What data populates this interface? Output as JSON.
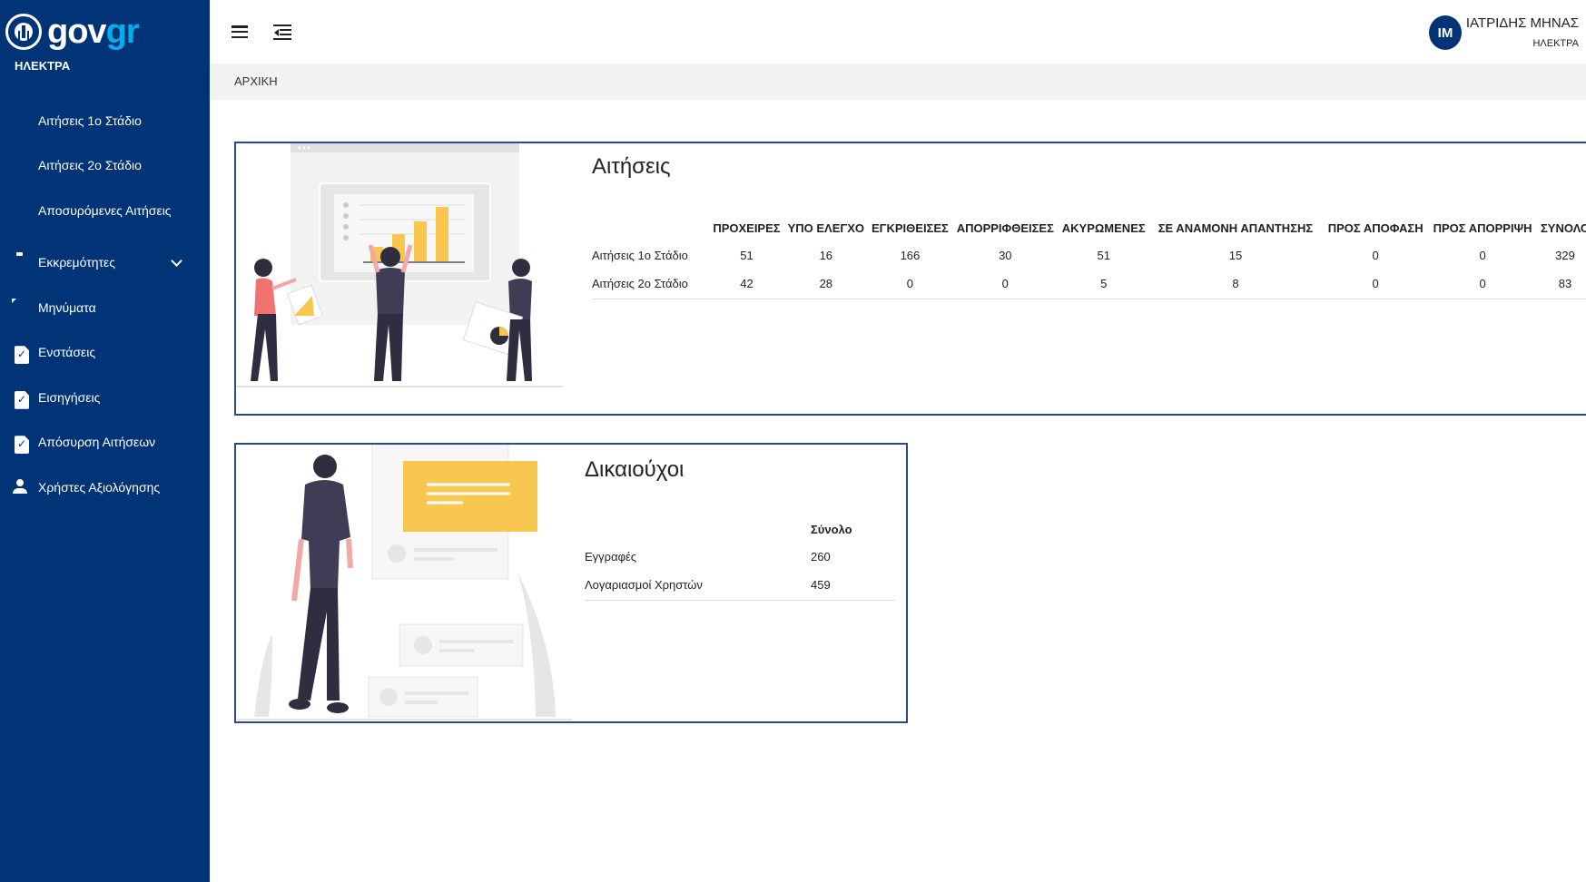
{
  "sidebar": {
    "logo_gov": "gov",
    "logo_gr": "gr",
    "org_name": "ΗΛΕΚΤΡΑ",
    "items": [
      {
        "label": "Αιτήσεις 1ο Στάδιο",
        "icon": "document-dollar-icon"
      },
      {
        "label": "Αιτήσεις 2ο Στάδιο",
        "icon": "document-dollar-icon"
      },
      {
        "label": "Αποσυρόμενες Αιτήσεις",
        "icon": "document-dollar-icon"
      },
      {
        "label": "Εκκρεμότητες",
        "icon": "clipboard-icon"
      },
      {
        "label": "Μηνύματα",
        "icon": "message-icon"
      },
      {
        "label": "Ενστάσεις",
        "icon": "document-check-icon"
      },
      {
        "label": "Εισηγήσεις",
        "icon": "document-check-icon"
      },
      {
        "label": "Απόσυρση Αιτήσεων",
        "icon": "document-check-icon"
      },
      {
        "label": "Χρήστες Αξιολόγησης",
        "icon": "user-icon"
      }
    ]
  },
  "header": {
    "user_initials": "IM",
    "user_name": "ΙΑΤΡΙΔΗΣ ΜΗΝΑΣ",
    "user_role": "ΗΛΕΚΤΡΑ"
  },
  "breadcrumb": "ΑΡΧΙΚΗ",
  "applications_card": {
    "title": "Αιτήσεις",
    "columns": [
      "ΠΡΟΧΕΙΡΕΣ",
      "ΥΠΟ ΕΛΕΓΧΟ",
      "ΕΓΚΡΙΘΕΙΣΕΣ",
      "ΑΠΟΡΡΙΦΘΕΙΣΕΣ",
      "ΑΚΥΡΩΜΕΝΕΣ",
      "ΣΕ ΑΝΑΜΟΝΗ ΑΠΑΝΤΗΣΗΣ",
      "ΠΡΟΣ ΑΠΟΦΑΣΗ",
      "ΠΡΟΣ ΑΠΟΡΡΙΨΗ",
      "ΣΥΝΟΛΟ"
    ],
    "rows": [
      {
        "label": "Αιτήσεις 1ο Στάδιο",
        "values": [
          "51",
          "16",
          "166",
          "30",
          "51",
          "15",
          "0",
          "0",
          "329"
        ]
      },
      {
        "label": "Αιτήσεις 2ο Στάδιο",
        "values": [
          "42",
          "28",
          "0",
          "0",
          "5",
          "8",
          "0",
          "0",
          "83"
        ]
      }
    ]
  },
  "beneficiaries_card": {
    "title": "Δικαιούχοι",
    "column": "Σύνολο",
    "rows": [
      {
        "label": "Εγγραφές",
        "value": "260"
      },
      {
        "label": "Λογαριασμοί Χρηστών",
        "value": "459"
      }
    ]
  },
  "colors": {
    "sidebar_bg": "#003476",
    "accent_yellow": "#f9c74f",
    "card_border": "#2b4a8a",
    "logo_gr": "#00aeef"
  }
}
